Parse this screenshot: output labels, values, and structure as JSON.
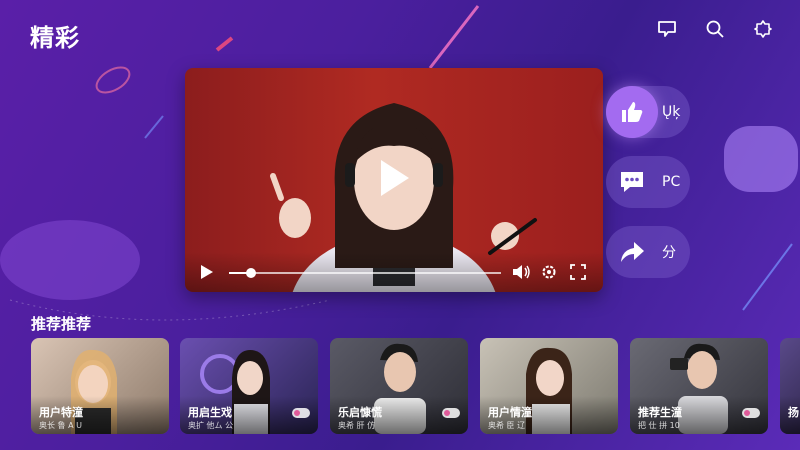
{
  "app": {
    "title": "精彩"
  },
  "header": {
    "icons": [
      "cast-icon",
      "search-icon",
      "settings-icon"
    ]
  },
  "player": {
    "progress": 0.08,
    "controls": [
      "play-icon",
      "volume-icon",
      "settings-gear-icon",
      "fullscreen-icon"
    ]
  },
  "actions": [
    {
      "icon": "thumbs-up-icon",
      "label": "Ųķ",
      "active": true
    },
    {
      "icon": "comment-icon",
      "label": "РС",
      "active": false
    },
    {
      "icon": "share-icon",
      "label": "分",
      "active": false
    }
  ],
  "section": {
    "title": "推荐推荐"
  },
  "cards": [
    {
      "title": "用户特潼",
      "subtitle": "奥长 鲁 A U"
    },
    {
      "title": "用启生戏",
      "subtitle": "奥扩 他ム 公"
    },
    {
      "title": "乐启慷慌",
      "subtitle": "奥希 肝 仿"
    },
    {
      "title": "用户情潼",
      "subtitle": "奥希 臣 辽"
    },
    {
      "title": "推荐生潼",
      "subtitle": "把 仕 拼 10"
    },
    {
      "title": "扬",
      "subtitle": ""
    }
  ],
  "colors": {
    "accent": "#a36bf0",
    "background_start": "#5a1fa8",
    "background_end": "#3a1d8e",
    "player_bg": "#b02a22"
  }
}
